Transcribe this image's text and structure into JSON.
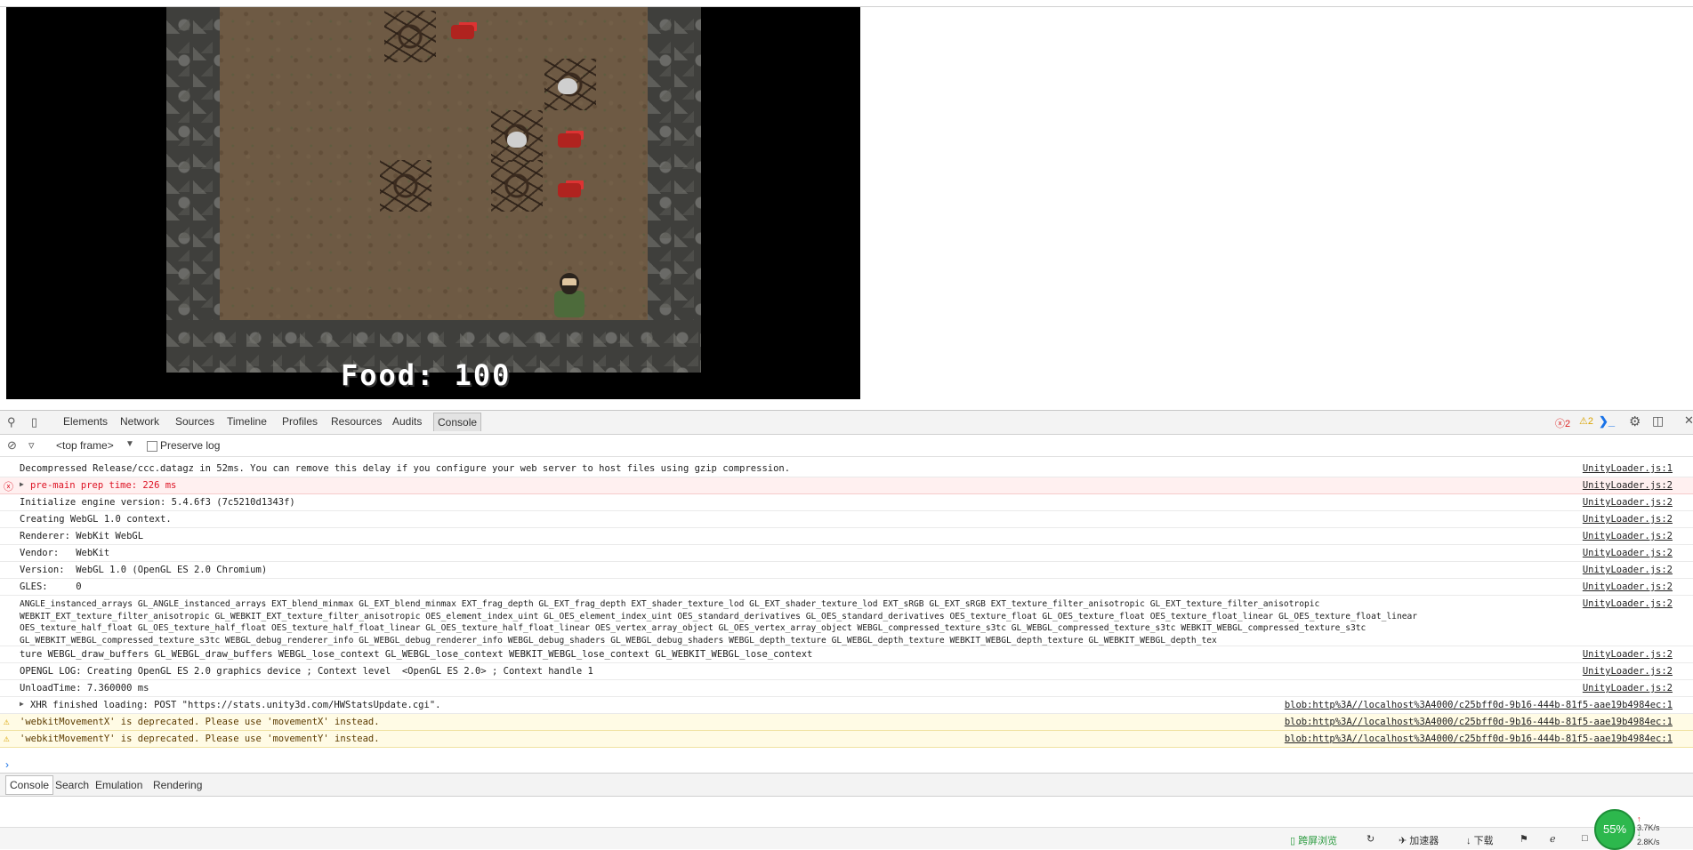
{
  "game": {
    "food_label": "Food: 100"
  },
  "devtools": {
    "tabs": [
      "Elements",
      "Network",
      "Sources",
      "Timeline",
      "Profiles",
      "Resources",
      "Audits",
      "Console"
    ],
    "active_tab": "Console",
    "error_count": "2",
    "warning_count": "2",
    "frame_selector": "<top frame>",
    "preserve_log_label": "Preserve log",
    "console_rows": [
      {
        "type": "log",
        "text": "Decompressed Release/ccc.datagz in 52ms. You can remove this delay if you configure your web server to host files using gzip compression.",
        "source": "UnityLoader.js:1"
      },
      {
        "type": "error",
        "text": "pre-main prep time: 226 ms",
        "source": "UnityLoader.js:2"
      },
      {
        "type": "log",
        "text": "Initialize engine version: 5.4.6f3 (7c5210d1343f)",
        "source": "UnityLoader.js:2"
      },
      {
        "type": "log",
        "text": "Creating WebGL 1.0 context.",
        "source": "UnityLoader.js:2"
      },
      {
        "type": "log",
        "text": "Renderer: WebKit WebGL",
        "source": "UnityLoader.js:2"
      },
      {
        "type": "log",
        "text": "Vendor:   WebKit",
        "source": "UnityLoader.js:2"
      },
      {
        "type": "log",
        "text": "Version:  WebGL 1.0 (OpenGL ES 2.0 Chromium)",
        "source": "UnityLoader.js:2"
      },
      {
        "type": "log",
        "text": "GLES:     0",
        "source": "UnityLoader.js:2"
      },
      {
        "type": "log",
        "text": "ANGLE_instanced_arrays GL_ANGLE_instanced_arrays EXT_blend_minmax GL_EXT_blend_minmax EXT_frag_depth GL_EXT_frag_depth EXT_shader_texture_lod GL_EXT_shader_texture_lod EXT_sRGB GL_EXT_sRGB EXT_texture_filter_anisotropic GL_EXT_texture_filter_anisotropic\nWEBKIT_EXT_texture_filter_anisotropic GL_WEBKIT_EXT_texture_filter_anisotropic OES_element_index_uint GL_OES_element_index_uint OES_standard_derivatives GL_OES_standard_derivatives OES_texture_float GL_OES_texture_float OES_texture_float_linear GL_OES_texture_float_linear\nOES_texture_half_float GL_OES_texture_half_float OES_texture_half_float_linear GL_OES_texture_half_float_linear OES_vertex_array_object GL_OES_vertex_array_object WEBGL_compressed_texture_s3tc GL_WEBGL_compressed_texture_s3tc WEBKIT_WEBGL_compressed_texture_s3tc\nGL_WEBKIT_WEBGL_compressed_texture_s3tc WEBGL_debug_renderer_info GL_WEBGL_debug_renderer_info WEBGL_debug_shaders GL_WEBGL_debug_shaders WEBGL_depth_texture GL_WEBGL_depth_texture WEBKIT_WEBGL_depth_texture GL_WEBKIT_WEBGL_depth_tex",
        "source": "UnityLoader.js:2"
      },
      {
        "type": "log",
        "text": "ture WEBGL_draw_buffers GL_WEBGL_draw_buffers WEBGL_lose_context GL_WEBGL_lose_context WEBKIT_WEBGL_lose_context GL_WEBKIT_WEBGL_lose_context",
        "source": "UnityLoader.js:2"
      },
      {
        "type": "log",
        "text": "OPENGL LOG: Creating OpenGL ES 2.0 graphics device ; Context level  <OpenGL ES 2.0> ; Context handle 1",
        "source": "UnityLoader.js:2"
      },
      {
        "type": "log",
        "text": "UnloadTime: 7.360000 ms",
        "source": "UnityLoader.js:2"
      },
      {
        "type": "xhr",
        "text": "XHR finished loading: POST \"https://stats.unity3d.com/HWStatsUpdate.cgi\".",
        "source": "blob:http%3A//localhost%3A4000/c25bff0d-9b16-444b-81f5-aae19b4984ec:1"
      },
      {
        "type": "warning",
        "text": "'webkitMovementX' is deprecated. Please use 'movementX' instead.",
        "source": "blob:http%3A//localhost%3A4000/c25bff0d-9b16-444b-81f5-aae19b4984ec:1"
      },
      {
        "type": "warning",
        "text": "'webkitMovementY' is deprecated. Please use 'movementY' instead.",
        "source": "blob:http%3A//localhost%3A4000/c25bff0d-9b16-444b-81f5-aae19b4984ec:1"
      }
    ],
    "drawer_tabs": [
      "Console",
      "Search",
      "Emulation",
      "Rendering"
    ],
    "drawer_active": "Console"
  },
  "statusbar": {
    "fullscreen": "跨屏浏览",
    "accelerator": "加速器",
    "download": "下载",
    "speed_percent": "55%",
    "upload_rate": "3.7K/s",
    "download_rate": "2.8K/s"
  },
  "colors": {
    "error": "#d12222",
    "warning": "#d9a300",
    "console_link": "#1a1aa6",
    "speed_badge": "#2db84d"
  },
  "icons": [
    "inspect-icon",
    "device-icon",
    "error-icon",
    "warning-icon",
    "terminal-icon",
    "settings-icon",
    "dock-icon",
    "close-icon",
    "clear-icon",
    "filter-icon",
    "dropdown-icon",
    "expand-triangle-icon",
    "prompt-icon"
  ]
}
